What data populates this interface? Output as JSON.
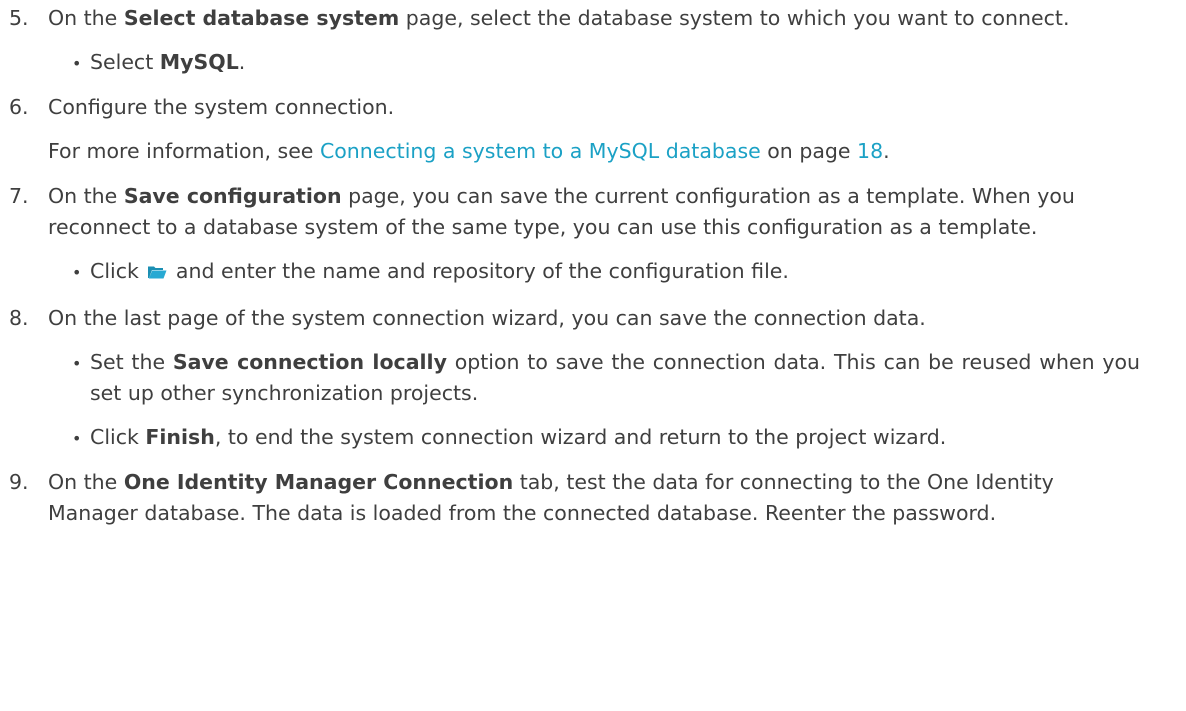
{
  "steps": [
    {
      "number": "5.",
      "pre": "On the ",
      "bold": "Select database system",
      "post": " page, select the database system to which you want to connect.",
      "bullets": [
        {
          "pre": "Select ",
          "bold": "MySQL",
          "post": "."
        }
      ]
    },
    {
      "number": "6.",
      "text": "Configure the system connection.",
      "info_pre": "For more information, see ",
      "info_link": "Connecting a system to a MySQL database",
      "info_mid": " on page ",
      "info_page": "18",
      "info_post": "."
    },
    {
      "number": "7.",
      "pre": "On the ",
      "bold": "Save configuration",
      "post": " page, you can save the current configuration as a template. When you reconnect to a database system of the same type, you can use this configuration as a template.",
      "bullet_pre": "Click ",
      "bullet_icon": "folder-open-icon",
      "bullet_post": " and enter the name and repository of the configuration file."
    },
    {
      "number": "8.",
      "text": "On the last page of the system connection wizard, you can save the connection data.",
      "bullets": [
        {
          "pre": "Set the ",
          "bold": "Save connection locally",
          "post": " option to save the connection data. This can be reused when you set up other synchronization projects."
        },
        {
          "pre": "Click ",
          "bold": "Finish",
          "post": ", to end the system connection wizard and return to the project wizard."
        }
      ]
    },
    {
      "number": "9.",
      "pre": "On the ",
      "bold": "One Identity Manager Connection",
      "post": " tab, test the data for connecting to the One Identity Manager database. The data is loaded from the connected database. Reenter the password."
    }
  ],
  "colors": {
    "text": "#3f3f3f",
    "link": "#1ba1c5",
    "folder_icon": "#1ba1c5"
  }
}
